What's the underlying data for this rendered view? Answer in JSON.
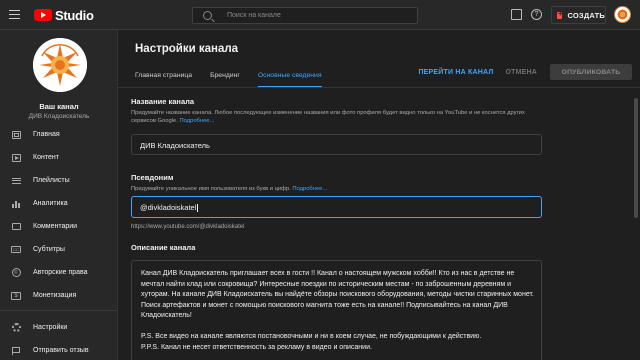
{
  "app": {
    "logo_text": "Studio"
  },
  "search": {
    "placeholder": "Поиск на канале"
  },
  "topbar": {
    "create_label": "СОЗДАТЬ",
    "help_glyph": "?"
  },
  "sidebar": {
    "your_channel": "Ваш канал",
    "channel_name": "ДИВ Кладоискатель",
    "items": [
      {
        "label": "Главная",
        "icon": "dashboard-icon"
      },
      {
        "label": "Контент",
        "icon": "content-icon"
      },
      {
        "label": "Плейлисты",
        "icon": "playlists-icon"
      },
      {
        "label": "Аналитика",
        "icon": "analytics-icon"
      },
      {
        "label": "Комментарии",
        "icon": "comments-icon"
      },
      {
        "label": "Субтитры",
        "icon": "subtitles-icon"
      },
      {
        "label": "Авторские права",
        "icon": "copyright-icon"
      },
      {
        "label": "Монетизация",
        "icon": "monetization-icon"
      }
    ],
    "bottom_items": [
      {
        "label": "Настройки",
        "icon": "settings-icon"
      },
      {
        "label": "Отправить отзыв",
        "icon": "feedback-icon"
      }
    ],
    "icon_glyphs": {
      "copyright": "©",
      "cc": "CC",
      "dollar": "$"
    }
  },
  "main": {
    "title": "Настройки канала",
    "tabs": [
      {
        "label": "Главная страница",
        "active": false
      },
      {
        "label": "Брендинг",
        "active": false
      },
      {
        "label": "Основные сведения",
        "active": true
      }
    ],
    "actions": {
      "go_to_channel": "ПЕРЕЙТИ НА КАНАЛ",
      "cancel": "ОТМЕНА",
      "publish": "ОПУБЛИКОВАТЬ"
    },
    "name_section": {
      "title": "Название канала",
      "description": "Придумайте название канала. Любое последующее изменение названия или фото профиля будет видно только на YouTube и не коснется других сервисов Google. ",
      "more": "Подробнее...",
      "value": "ДИВ Кладоискатель"
    },
    "handle_section": {
      "title": "Псевдоним",
      "description": "Придумайте уникальное имя пользователя из букв и цифр. ",
      "more": "Подробнее...",
      "value": "@divkladoiskatel",
      "url": "https://www.youtube.com/@divkladoiskatel"
    },
    "description_section": {
      "title": "Описание канала",
      "text": "Канал ДИВ Кладоискатель приглашает всех в гости !! Канал о настоящем мужском хобби!! Кто из нас в детстве не мечтал найти клад или сокровища? Интересные поездки по историческим местам - по заброшенным деревням и хуторам. На канале ДИВ Кладоискатель вы найдёте обзоры поискового оборудования, методы чистки старинных монет. Поиск артефактов и монет с помощью поискового магнита тоже есть на канале!! Подписывайтесь на канал ДИВ Кладоискатель!\n\nP.S. Все видео на канале являются постановочными и ни в коем случае, не побуждающими к действию.\nP.P.S. Канал не несет ответственность за рекламу в видео и описании."
    }
  },
  "colors": {
    "accent": "#3ea6ff",
    "brand": "#ff0000",
    "background": "#1f1f1f",
    "panel": "#282828"
  }
}
